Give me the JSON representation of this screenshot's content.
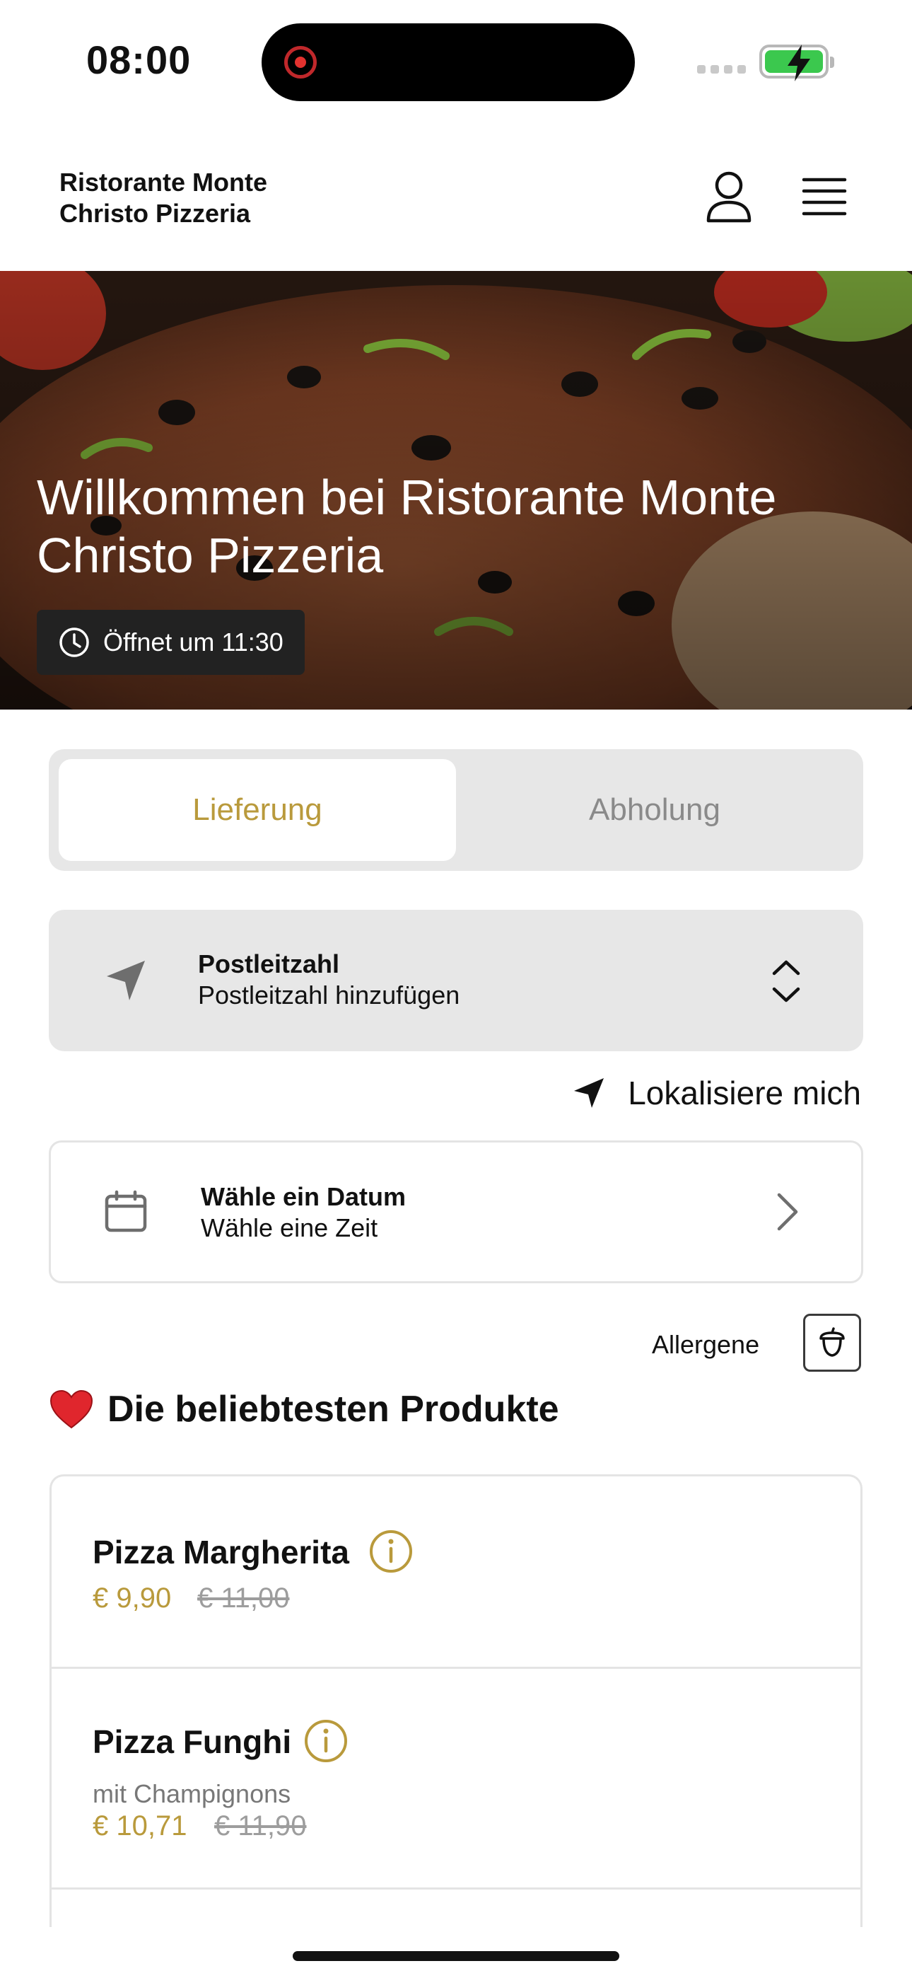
{
  "status_bar": {
    "time": "08:00"
  },
  "header": {
    "brand_line1": "Ristorante Monte",
    "brand_line2": "Christo Pizzeria"
  },
  "hero": {
    "title": "Willkommen bei Ristorante Monte Christo Pizzeria",
    "opening": "Öffnet um 11:30"
  },
  "tabs": [
    {
      "label": "Lieferung",
      "active": true
    },
    {
      "label": "Abholung",
      "active": false
    }
  ],
  "postcode": {
    "label": "Postleitzahl",
    "value": "Postleitzahl hinzufügen"
  },
  "locate": {
    "label": "Lokalisiere mich"
  },
  "schedule": {
    "label": "Wähle ein Datum",
    "value": "Wähle eine Zeit"
  },
  "allergens": {
    "label": "Allergene"
  },
  "section": {
    "title": "Die beliebtesten Produkte"
  },
  "products": [
    {
      "name": "Pizza Margherita",
      "description": "",
      "price": "€ 9,90",
      "old_price": "€ 11,00"
    },
    {
      "name": "Pizza Funghi",
      "description": "mit Champignons",
      "price": "€ 10,71",
      "old_price": "€ 11,90"
    }
  ],
  "colors": {
    "accent": "#b99a3c",
    "panel": "#e7e7e7",
    "border": "#e4e4e4"
  }
}
